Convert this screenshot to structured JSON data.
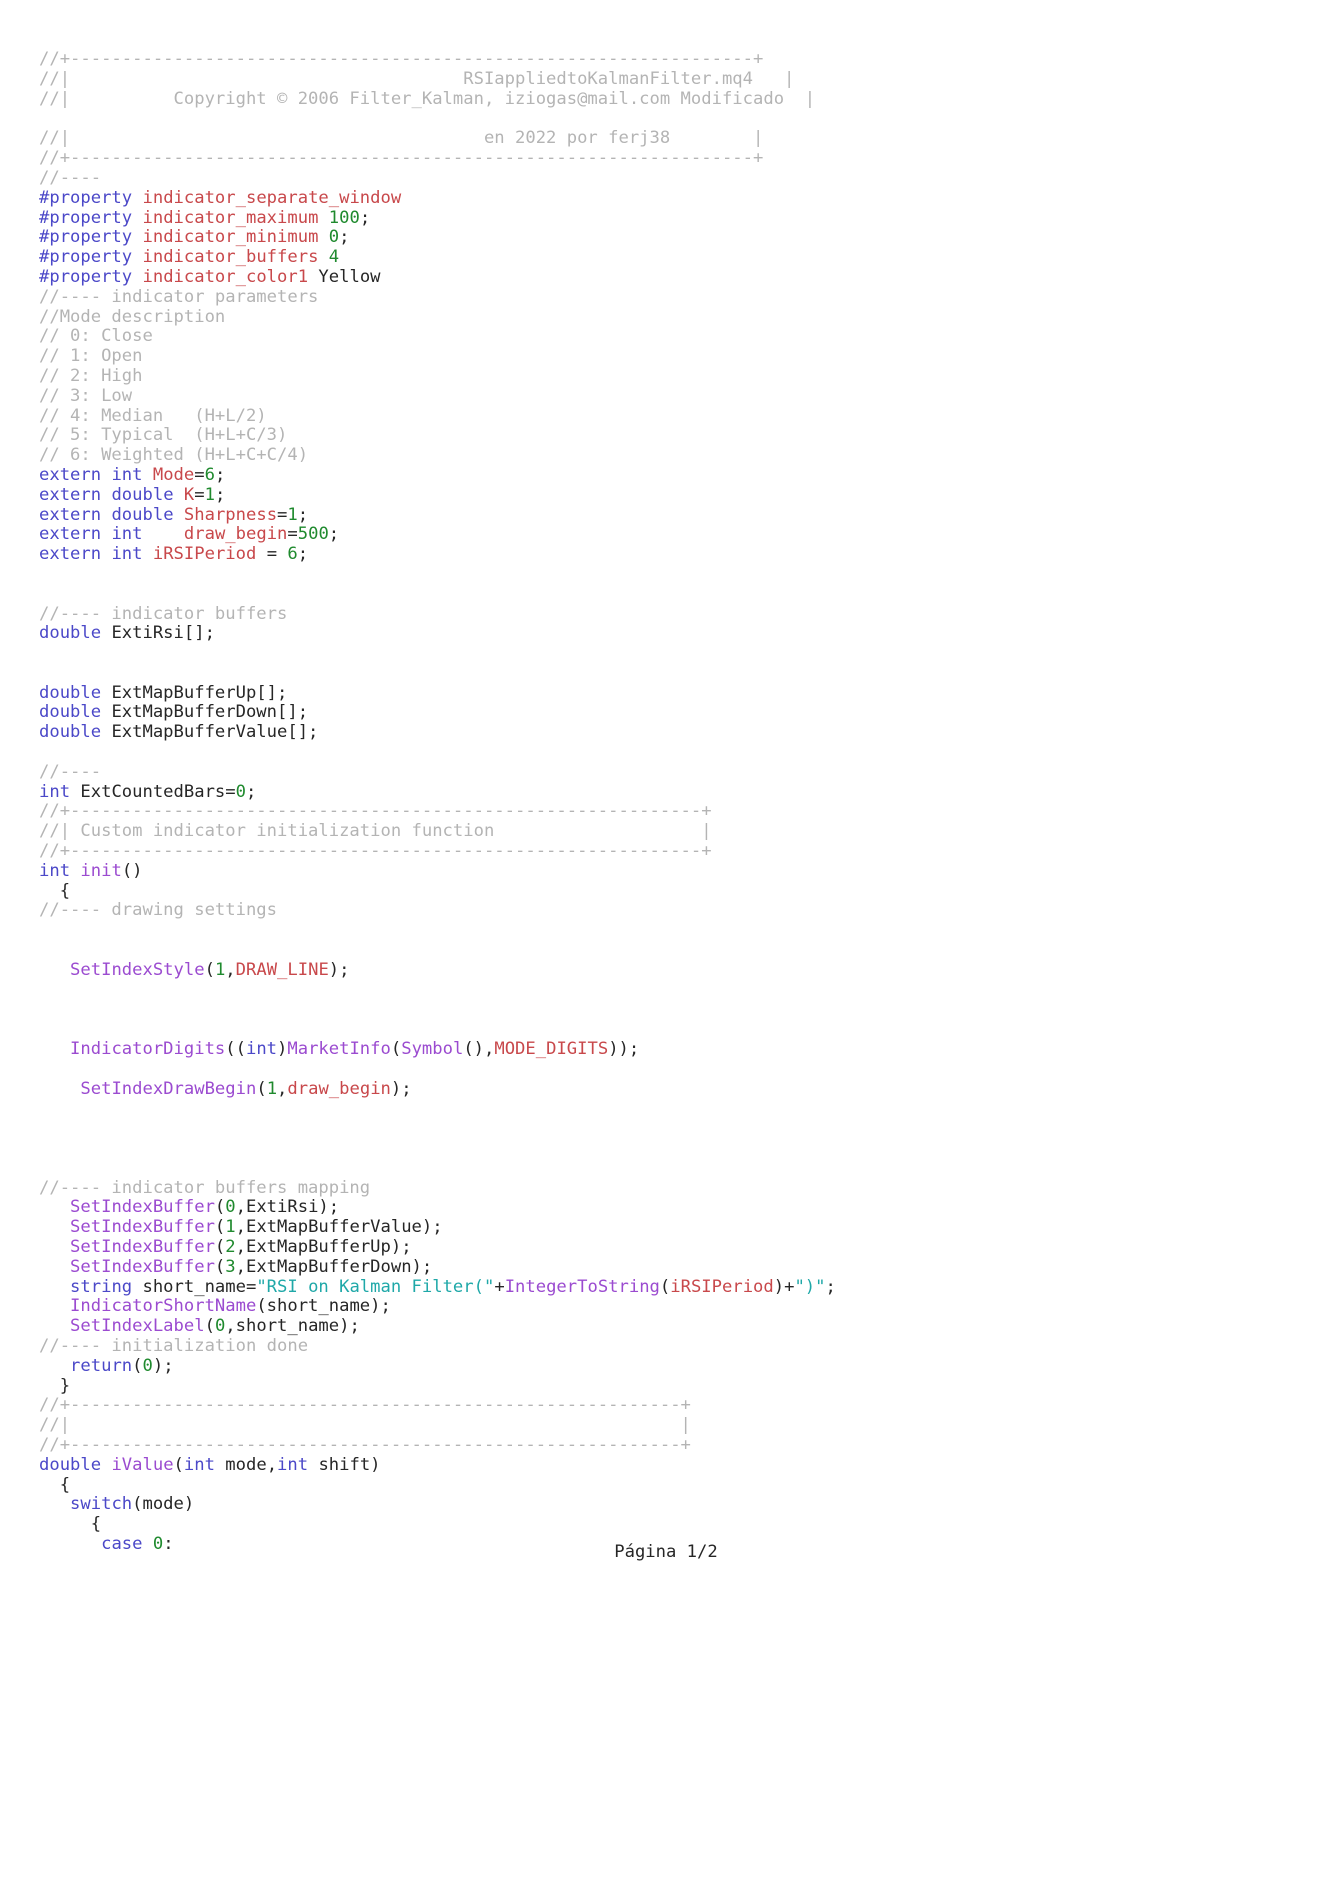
{
  "document": {
    "footer_label": "Página 1/2",
    "colors": {
      "comment": "#b4b4b4",
      "keyword": "#4b48c8",
      "identifier": "#c8484b",
      "number": "#1f8a2e",
      "function": "#9b4bd0",
      "string": "#1fa8a8",
      "plain": "#262626",
      "background": "#ffffff"
    }
  },
  "code": {
    "lines": [
      [
        [
          "cm",
          "//+------------------------------------------------------------------+"
        ]
      ],
      [
        [
          "cm",
          "//|                                      RSIappliedtoKalmanFilter.mq4   |"
        ]
      ],
      [
        [
          "cm",
          "//|          Copyright © 2006 Filter_Kalman, iziogas@mail.com Modificado  |"
        ]
      ],
      [
        [
          "pl",
          ""
        ]
      ],
      [
        [
          "cm",
          "//|                                        en 2022 por ferj38        |"
        ]
      ],
      [
        [
          "cm",
          "//+------------------------------------------------------------------+"
        ]
      ],
      [
        [
          "cm",
          "//----"
        ]
      ],
      [
        [
          "kw",
          "#property"
        ],
        [
          "pl",
          " "
        ],
        [
          "id",
          "indicator_separate_window"
        ]
      ],
      [
        [
          "kw",
          "#property"
        ],
        [
          "pl",
          " "
        ],
        [
          "id",
          "indicator_maximum"
        ],
        [
          "pl",
          " "
        ],
        [
          "nu",
          "100"
        ],
        [
          "pl",
          ";"
        ]
      ],
      [
        [
          "kw",
          "#property"
        ],
        [
          "pl",
          " "
        ],
        [
          "id",
          "indicator_minimum"
        ],
        [
          "pl",
          " "
        ],
        [
          "nu",
          "0"
        ],
        [
          "pl",
          ";"
        ]
      ],
      [
        [
          "kw",
          "#property"
        ],
        [
          "pl",
          " "
        ],
        [
          "id",
          "indicator_buffers"
        ],
        [
          "pl",
          " "
        ],
        [
          "nu",
          "4"
        ]
      ],
      [
        [
          "kw",
          "#property"
        ],
        [
          "pl",
          " "
        ],
        [
          "id",
          "indicator_color1"
        ],
        [
          "pl",
          " Yellow"
        ]
      ],
      [
        [
          "cm",
          "//---- indicator parameters"
        ]
      ],
      [
        [
          "cm",
          "//Mode description"
        ]
      ],
      [
        [
          "cm",
          "// 0: Close"
        ]
      ],
      [
        [
          "cm",
          "// 1: Open"
        ]
      ],
      [
        [
          "cm",
          "// 2: High"
        ]
      ],
      [
        [
          "cm",
          "// 3: Low"
        ]
      ],
      [
        [
          "cm",
          "// 4: Median   (H+L/2)"
        ]
      ],
      [
        [
          "cm",
          "// 5: Typical  (H+L+C/3)"
        ]
      ],
      [
        [
          "cm",
          "// 6: Weighted (H+L+C+C/4)"
        ]
      ],
      [
        [
          "kw",
          "extern"
        ],
        [
          "pl",
          " "
        ],
        [
          "kw",
          "int"
        ],
        [
          "pl",
          " "
        ],
        [
          "id",
          "Mode"
        ],
        [
          "pl",
          "="
        ],
        [
          "nu",
          "6"
        ],
        [
          "pl",
          ";"
        ]
      ],
      [
        [
          "kw",
          "extern"
        ],
        [
          "pl",
          " "
        ],
        [
          "kw",
          "double"
        ],
        [
          "pl",
          " "
        ],
        [
          "id",
          "K"
        ],
        [
          "pl",
          "="
        ],
        [
          "nu",
          "1"
        ],
        [
          "pl",
          ";"
        ]
      ],
      [
        [
          "kw",
          "extern"
        ],
        [
          "pl",
          " "
        ],
        [
          "kw",
          "double"
        ],
        [
          "pl",
          " "
        ],
        [
          "id",
          "Sharpness"
        ],
        [
          "pl",
          "="
        ],
        [
          "nu",
          "1"
        ],
        [
          "pl",
          ";"
        ]
      ],
      [
        [
          "kw",
          "extern"
        ],
        [
          "pl",
          " "
        ],
        [
          "kw",
          "int"
        ],
        [
          "pl",
          "    "
        ],
        [
          "id",
          "draw_begin"
        ],
        [
          "pl",
          "="
        ],
        [
          "nu",
          "500"
        ],
        [
          "pl",
          ";"
        ]
      ],
      [
        [
          "kw",
          "extern"
        ],
        [
          "pl",
          " "
        ],
        [
          "kw",
          "int"
        ],
        [
          "pl",
          " "
        ],
        [
          "id",
          "iRSIPeriod"
        ],
        [
          "pl",
          " = "
        ],
        [
          "nu",
          "6"
        ],
        [
          "pl",
          ";"
        ]
      ],
      [
        [
          "pl",
          ""
        ]
      ],
      [
        [
          "pl",
          ""
        ]
      ],
      [
        [
          "cm",
          "//---- indicator buffers"
        ]
      ],
      [
        [
          "kw",
          "double"
        ],
        [
          "pl",
          " ExtiRsi[];"
        ]
      ],
      [
        [
          "pl",
          ""
        ]
      ],
      [
        [
          "pl",
          ""
        ]
      ],
      [
        [
          "kw",
          "double"
        ],
        [
          "pl",
          " ExtMapBufferUp[];"
        ]
      ],
      [
        [
          "kw",
          "double"
        ],
        [
          "pl",
          " ExtMapBufferDown[];"
        ]
      ],
      [
        [
          "kw",
          "double"
        ],
        [
          "pl",
          " ExtMapBufferValue[];"
        ]
      ],
      [
        [
          "pl",
          ""
        ]
      ],
      [
        [
          "cm",
          "//----"
        ]
      ],
      [
        [
          "kw",
          "int"
        ],
        [
          "pl",
          " ExtCountedBars="
        ],
        [
          "nu",
          "0"
        ],
        [
          "pl",
          ";"
        ]
      ],
      [
        [
          "cm",
          "//+-------------------------------------------------------------+"
        ]
      ],
      [
        [
          "cm",
          "//| Custom indicator initialization function                    |"
        ]
      ],
      [
        [
          "cm",
          "//+-------------------------------------------------------------+"
        ]
      ],
      [
        [
          "kw",
          "int"
        ],
        [
          "pl",
          " "
        ],
        [
          "fn",
          "init"
        ],
        [
          "pl",
          "()"
        ]
      ],
      [
        [
          "pl",
          "  {"
        ]
      ],
      [
        [
          "cm",
          "//---- drawing settings"
        ]
      ],
      [
        [
          "pl",
          ""
        ]
      ],
      [
        [
          "pl",
          ""
        ]
      ],
      [
        [
          "pl",
          "   "
        ],
        [
          "fn",
          "SetIndexStyle"
        ],
        [
          "pl",
          "("
        ],
        [
          "nu",
          "1"
        ],
        [
          "pl",
          ","
        ],
        [
          "id",
          "DRAW_LINE"
        ],
        [
          "pl",
          ");"
        ]
      ],
      [
        [
          "pl",
          ""
        ]
      ],
      [
        [
          "pl",
          ""
        ]
      ],
      [
        [
          "pl",
          ""
        ]
      ],
      [
        [
          "pl",
          "   "
        ],
        [
          "fn",
          "IndicatorDigits"
        ],
        [
          "pl",
          "(("
        ],
        [
          "kw",
          "int"
        ],
        [
          "pl",
          ")"
        ],
        [
          "fn",
          "MarketInfo"
        ],
        [
          "pl",
          "("
        ],
        [
          "fn",
          "Symbol"
        ],
        [
          "pl",
          "(),"
        ],
        [
          "id",
          "MODE_DIGITS"
        ],
        [
          "pl",
          "));"
        ]
      ],
      [
        [
          "pl",
          ""
        ]
      ],
      [
        [
          "pl",
          "    "
        ],
        [
          "fn",
          "SetIndexDrawBegin"
        ],
        [
          "pl",
          "("
        ],
        [
          "nu",
          "1"
        ],
        [
          "pl",
          ","
        ],
        [
          "id",
          "draw_begin"
        ],
        [
          "pl",
          ");"
        ]
      ],
      [
        [
          "pl",
          ""
        ]
      ],
      [
        [
          "pl",
          ""
        ]
      ],
      [
        [
          "pl",
          ""
        ]
      ],
      [
        [
          "pl",
          ""
        ]
      ],
      [
        [
          "cm",
          "//---- indicator buffers mapping"
        ]
      ],
      [
        [
          "pl",
          "   "
        ],
        [
          "fn",
          "SetIndexBuffer"
        ],
        [
          "pl",
          "("
        ],
        [
          "nu",
          "0"
        ],
        [
          "pl",
          ",ExtiRsi);"
        ]
      ],
      [
        [
          "pl",
          "   "
        ],
        [
          "fn",
          "SetIndexBuffer"
        ],
        [
          "pl",
          "("
        ],
        [
          "nu",
          "1"
        ],
        [
          "pl",
          ",ExtMapBufferValue);"
        ]
      ],
      [
        [
          "pl",
          "   "
        ],
        [
          "fn",
          "SetIndexBuffer"
        ],
        [
          "pl",
          "("
        ],
        [
          "nu",
          "2"
        ],
        [
          "pl",
          ",ExtMapBufferUp);"
        ]
      ],
      [
        [
          "pl",
          "   "
        ],
        [
          "fn",
          "SetIndexBuffer"
        ],
        [
          "pl",
          "("
        ],
        [
          "nu",
          "3"
        ],
        [
          "pl",
          ",ExtMapBufferDown);"
        ]
      ],
      [
        [
          "pl",
          "   "
        ],
        [
          "kw",
          "string"
        ],
        [
          "pl",
          " short_name="
        ],
        [
          "st",
          "\"RSI on Kalman Filter(\""
        ],
        [
          "pl",
          "+"
        ],
        [
          "fn",
          "IntegerToString"
        ],
        [
          "pl",
          "("
        ],
        [
          "id",
          "iRSIPeriod"
        ],
        [
          "pl",
          ")+"
        ],
        [
          "st",
          "\")\""
        ],
        [
          "pl",
          ";"
        ]
      ],
      [
        [
          "pl",
          "   "
        ],
        [
          "fn",
          "IndicatorShortName"
        ],
        [
          "pl",
          "(short_name);"
        ]
      ],
      [
        [
          "pl",
          "   "
        ],
        [
          "fn",
          "SetIndexLabel"
        ],
        [
          "pl",
          "("
        ],
        [
          "nu",
          "0"
        ],
        [
          "pl",
          ",short_name);"
        ]
      ],
      [
        [
          "cm",
          "//---- initialization done"
        ]
      ],
      [
        [
          "pl",
          "   "
        ],
        [
          "kw",
          "return"
        ],
        [
          "pl",
          "("
        ],
        [
          "nu",
          "0"
        ],
        [
          "pl",
          ");"
        ]
      ],
      [
        [
          "pl",
          "  }"
        ]
      ],
      [
        [
          "cm",
          "//+-----------------------------------------------------------+"
        ]
      ],
      [
        [
          "cm",
          "//|                                                           |"
        ]
      ],
      [
        [
          "cm",
          "//+-----------------------------------------------------------+"
        ]
      ],
      [
        [
          "kw",
          "double"
        ],
        [
          "pl",
          " "
        ],
        [
          "fn",
          "iValue"
        ],
        [
          "pl",
          "("
        ],
        [
          "kw",
          "int"
        ],
        [
          "pl",
          " mode,"
        ],
        [
          "kw",
          "int"
        ],
        [
          "pl",
          " shift)"
        ]
      ],
      [
        [
          "pl",
          "  {"
        ]
      ],
      [
        [
          "pl",
          "   "
        ],
        [
          "kw",
          "switch"
        ],
        [
          "pl",
          "(mode)"
        ]
      ],
      [
        [
          "pl",
          "     {"
        ]
      ],
      [
        [
          "pl",
          "      "
        ],
        [
          "kw",
          "case"
        ],
        [
          "pl",
          " "
        ],
        [
          "nu",
          "0"
        ],
        [
          "pl",
          ":"
        ]
      ]
    ]
  }
}
